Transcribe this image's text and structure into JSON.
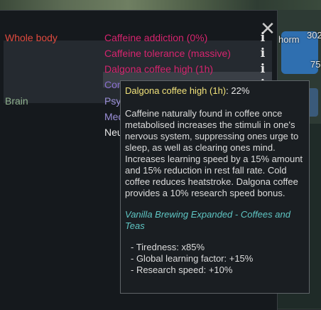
{
  "world": {
    "labels": [
      {
        "text": "302",
        "name": "world-number-302"
      },
      {
        "text": "horm",
        "name": "world-label-horm"
      },
      {
        "text": "75",
        "name": "world-number-75"
      }
    ]
  },
  "panel": {
    "close_label": "✕",
    "rows": [
      {
        "part": "Whole body",
        "part_color": "#e04a3f",
        "hediff": "Caffeine addiction (0%)",
        "hediff_color": "#d6246e",
        "info": true
      },
      {
        "part": "",
        "hediff": "Caffeine tolerance (massive)",
        "hediff_color": "#d6246e",
        "info": true
      },
      {
        "part": "",
        "hediff": "Dalgona coffee high (1h)",
        "hediff_color": "#d6246e",
        "info": true
      },
      {
        "part": "",
        "hediff": "Con",
        "hediff_color": "#8a6fd0",
        "info": true
      },
      {
        "part": "Brain",
        "part_color": "#8fb08e",
        "hediff": "Psy",
        "hediff_color": "#9b8fd8",
        "info": false
      },
      {
        "part": "",
        "hediff": "Med",
        "hediff_color": "#9b8fd8",
        "info": false
      },
      {
        "part": "",
        "hediff": "Neu",
        "hediff_color": "#e8e8e8",
        "info": false
      }
    ]
  },
  "tooltip": {
    "title_name": "Dalgona coffee high (1h)",
    "title_rest": ": 22%",
    "description": "Caffeine naturally found in coffee once metabolised increases the stimuli in one's nervous system, suppressing ones urge to sleep, as well as clearing ones mind. Increases learning speed by a 15% amount and 15% reduction in rest fall rate. Cold coffee reduces heatstroke. Dalgona coffee provides a 10% research speed bonus.",
    "source": "Vanilla Brewing Expanded - Coffees and Teas",
    "stats": [
      "- Tiredness: x85%",
      "- Global learning factor: +15%",
      "- Research speed: +10%"
    ]
  }
}
